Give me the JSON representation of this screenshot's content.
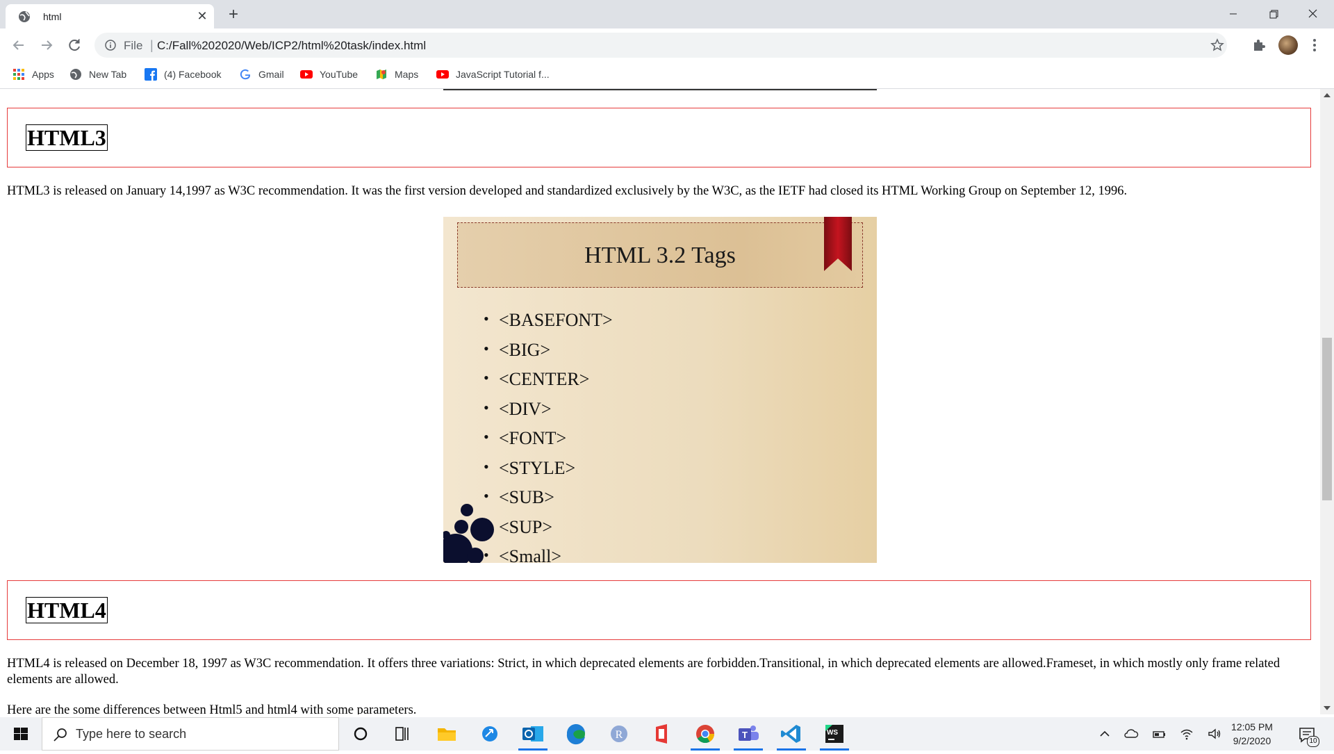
{
  "browser": {
    "tab_title": "html",
    "omnibox_scheme": "File",
    "url": "C:/Fall%202020/Web/ICP2/html%20task/index.html",
    "bookmarks": [
      {
        "label": "Apps",
        "icon": "apps-grid-icon"
      },
      {
        "label": "New Tab",
        "icon": "globe-icon"
      },
      {
        "label": "(4) Facebook",
        "icon": "facebook-icon"
      },
      {
        "label": "Gmail",
        "icon": "google-icon"
      },
      {
        "label": "YouTube",
        "icon": "youtube-icon"
      },
      {
        "label": "Maps",
        "icon": "maps-icon"
      },
      {
        "label": "JavaScript Tutorial f...",
        "icon": "youtube-icon"
      }
    ]
  },
  "page": {
    "html3": {
      "heading": "HTML3",
      "text": "HTML3 is released on January 14,1997 as W3C recommendation. It was the first version developed and standardized exclusively by the W3C, as the IETF had closed its HTML Working Group on September 12, 1996."
    },
    "slide": {
      "title": "HTML 3.2 Tags",
      "tags": [
        "<BASEFONT>",
        "<BIG>",
        "<CENTER>",
        "<DIV>",
        "<FONT>",
        "<STYLE>",
        "<SUB>",
        "<SUP>",
        "<Small>"
      ]
    },
    "html4": {
      "heading": "HTML4",
      "text": "HTML4 is released on December 18, 1997 as W3C recommendation. It offers three variations: Strict, in which deprecated elements are forbidden.Transitional, in which deprecated elements are allowed.Frameset, in which mostly only frame related elements are allowed.",
      "differences_intro": "Here are the some differences between Html5 and html4 with some parameters."
    }
  },
  "taskbar": {
    "search_placeholder": "Type here to search",
    "time": "12:05 PM",
    "date": "9/2/2020",
    "notification_count": "10"
  },
  "colors": {
    "section_border": "#e63b3b",
    "tab_strip": "#dee1e6",
    "taskbar": "#f0f2f5"
  }
}
